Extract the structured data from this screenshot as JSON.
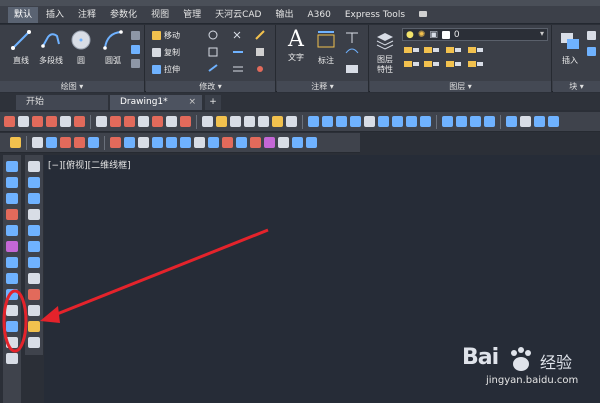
{
  "ribbon_tabs": [
    "默认",
    "插入",
    "注释",
    "参数化",
    "视图",
    "管理",
    "天河云CAD",
    "输出",
    "A360",
    "Express Tools"
  ],
  "draw_panel": {
    "title": "绘图 ▾",
    "line": "直线",
    "polyline": "多段线",
    "circle": "圆",
    "arc": "圆弧"
  },
  "modify_panel": {
    "title": "修改 ▾",
    "move": "移动",
    "copy": "复制",
    "stretch": "拉伸"
  },
  "annotate_panel": {
    "title": "注释 ▾",
    "text": "文字",
    "dimension": "标注"
  },
  "layers_panel": {
    "title": "图层 ▾",
    "layer_properties": "图层\n特性",
    "current_layer": "0"
  },
  "block_panel": {
    "title": "块 ▾",
    "insert": "插入"
  },
  "doc_tabs": {
    "start": "开始",
    "drawing": "Drawing1*",
    "close": "×",
    "add": "+"
  },
  "viewport_label": "[−][俯视][二维线框]",
  "watermark": {
    "brand": "Bai",
    "cn": "经验",
    "url": "jingyan.baidu.com"
  },
  "colors": {
    "accent_red": "#e4232b",
    "canvas": "#262c37",
    "ribbon": "#3b3f48"
  }
}
